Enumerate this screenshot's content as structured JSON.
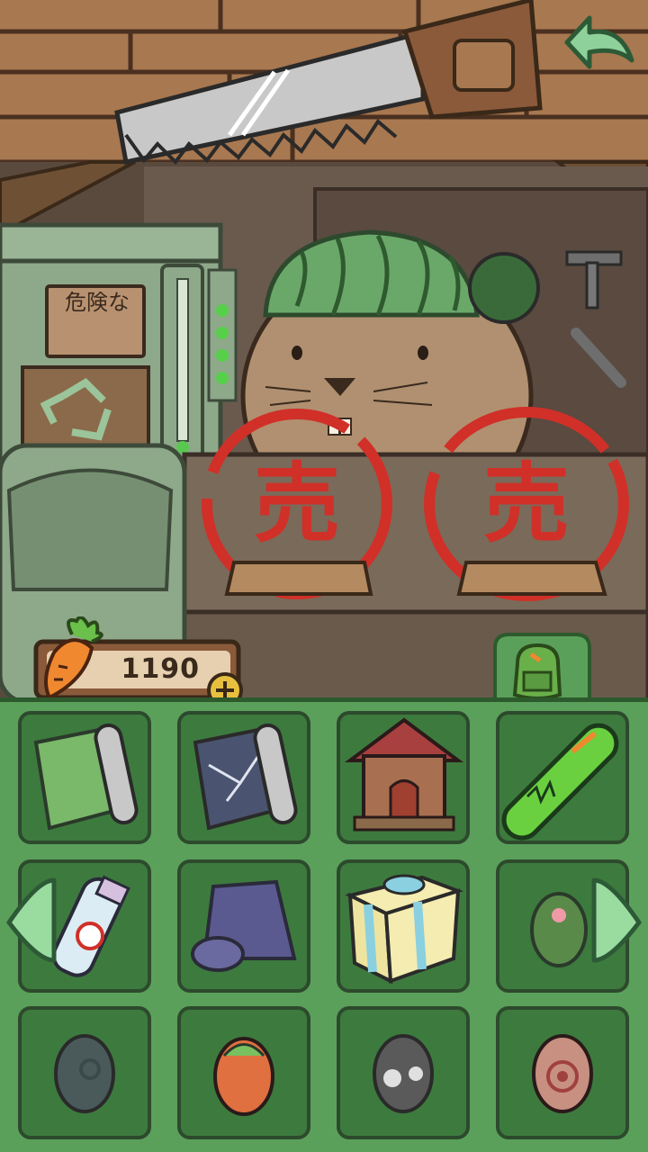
{
  "shop": {
    "sign_text": "危険な",
    "sold_stamp_1": "売",
    "sold_stamp_2": "売"
  },
  "currency": {
    "icon": "carrot-icon",
    "amount": "1190",
    "add_icon": "plus-icon"
  },
  "nav": {
    "back_icon": "back-arrow-icon",
    "bag_icon": "backpack-icon",
    "prev_icon": "left-arrow-icon",
    "next_icon": "right-arrow-icon"
  },
  "inventory": {
    "items": [
      {
        "icon": "green-wallpaper-roll-icon"
      },
      {
        "icon": "cracked-wallpaper-roll-icon"
      },
      {
        "icon": "doghouse-icon"
      },
      {
        "icon": "skateboard-icon"
      },
      {
        "icon": "spray-can-icon"
      },
      {
        "icon": "rolled-rug-icon"
      },
      {
        "icon": "gift-box-icon"
      },
      {
        "icon": "flower-egg-icon"
      },
      {
        "icon": "dark-swirl-egg-icon"
      },
      {
        "icon": "carrot-egg-icon"
      },
      {
        "icon": "gray-spotted-egg-icon"
      },
      {
        "icon": "target-egg-icon"
      }
    ]
  },
  "colors": {
    "panel_green": "#5aa05a",
    "cell_green": "#3d7a3e",
    "stamp_red": "#d03028",
    "wood_brown": "#8a5a3a"
  }
}
